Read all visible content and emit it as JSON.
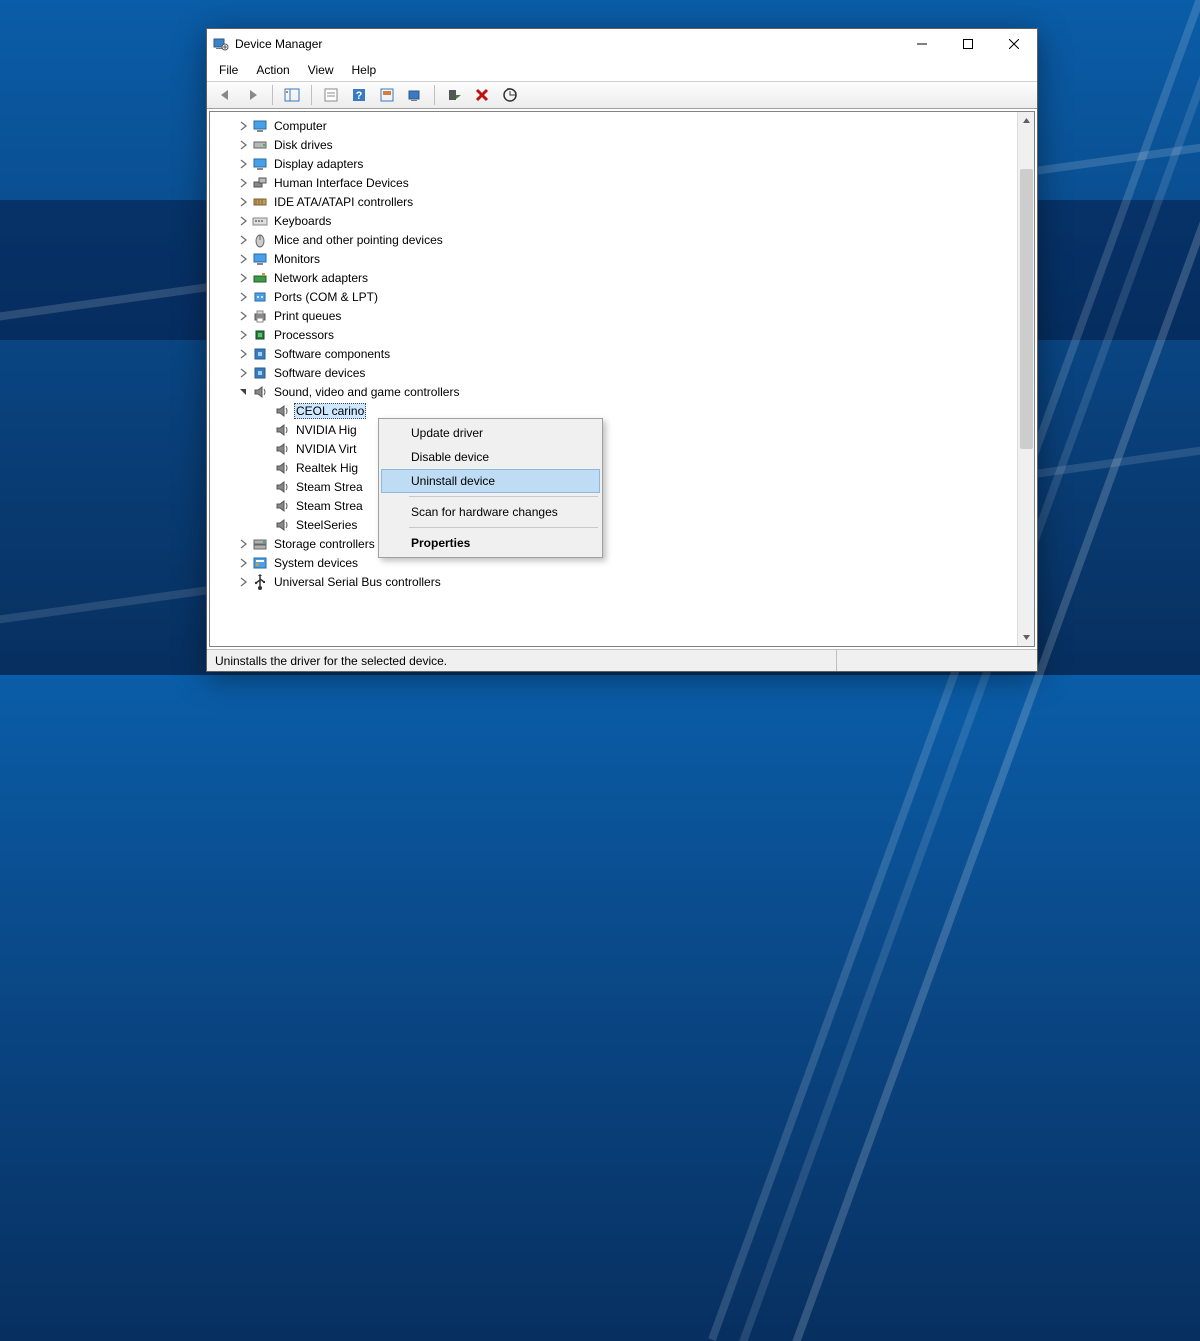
{
  "window": {
    "title": "Device Manager",
    "minimize_tooltip": "Minimize",
    "maximize_tooltip": "Maximize",
    "close_tooltip": "Close"
  },
  "menubar": [
    "File",
    "Action",
    "View",
    "Help"
  ],
  "toolbar": {
    "back": "Back",
    "forward": "Forward",
    "show_hide_tree": "Show/Hide Console Tree",
    "properties": "Properties",
    "help": "Help",
    "action_center": "Update Driver",
    "update": "Update device driver",
    "enable": "Enable device",
    "uninstall": "Uninstall device",
    "scan": "Scan for hardware changes"
  },
  "tree": {
    "categories": [
      {
        "label": "Computer",
        "icon": "monitor"
      },
      {
        "label": "Disk drives",
        "icon": "drive"
      },
      {
        "label": "Display adapters",
        "icon": "monitor"
      },
      {
        "label": "Human Interface Devices",
        "icon": "hid"
      },
      {
        "label": "IDE ATA/ATAPI controllers",
        "icon": "ide"
      },
      {
        "label": "Keyboards",
        "icon": "keyboard"
      },
      {
        "label": "Mice and other pointing devices",
        "icon": "mouse"
      },
      {
        "label": "Monitors",
        "icon": "monitor"
      },
      {
        "label": "Network adapters",
        "icon": "network"
      },
      {
        "label": "Ports (COM & LPT)",
        "icon": "port"
      },
      {
        "label": "Print queues",
        "icon": "printer"
      },
      {
        "label": "Processors",
        "icon": "cpu"
      },
      {
        "label": "Software components",
        "icon": "component"
      },
      {
        "label": "Software devices",
        "icon": "component"
      }
    ],
    "sound_category": {
      "label": "Sound, video and game controllers",
      "icon": "speaker"
    },
    "sound_children": [
      {
        "label": "CEOL carino",
        "selected": true
      },
      {
        "label": "NVIDIA Hig"
      },
      {
        "label": "NVIDIA Virt"
      },
      {
        "label": "Realtek Hig"
      },
      {
        "label": "Steam Strea"
      },
      {
        "label": "Steam Strea"
      },
      {
        "label": "SteelSeries"
      }
    ],
    "categories_after": [
      {
        "label": "Storage controllers",
        "icon": "storage"
      },
      {
        "label": "System devices",
        "icon": "system"
      },
      {
        "label": "Universal Serial Bus controllers",
        "icon": "usb"
      }
    ]
  },
  "context_menu": {
    "items": [
      {
        "label": "Update driver",
        "hover": false
      },
      {
        "label": "Disable device",
        "hover": false
      },
      {
        "label": "Uninstall device",
        "hover": true
      },
      {
        "sep": true
      },
      {
        "label": "Scan for hardware changes",
        "hover": false
      },
      {
        "sep": true
      },
      {
        "label": "Properties",
        "hover": false,
        "bold": true
      }
    ]
  },
  "statusbar": {
    "text": "Uninstalls the driver for the selected device."
  }
}
